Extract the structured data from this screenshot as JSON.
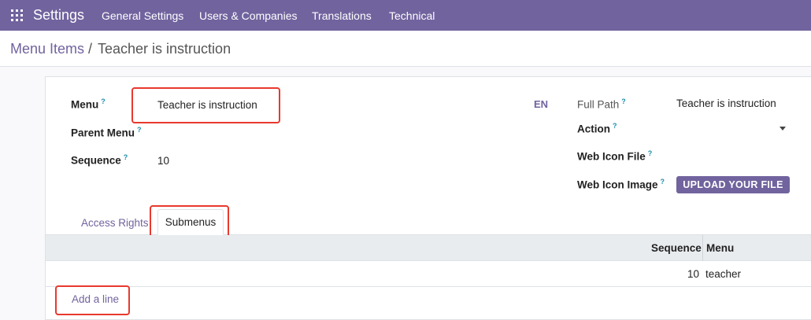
{
  "topbar": {
    "app_name": "Settings",
    "menu": [
      "General Settings",
      "Users & Companies",
      "Translations",
      "Technical"
    ]
  },
  "breadcrumb": {
    "parent": "Menu Items",
    "separator": "/",
    "current": "Teacher is instruction"
  },
  "form": {
    "menu_label": "Menu",
    "menu_value": "Teacher is instruction",
    "parent_menu_label": "Parent Menu",
    "parent_menu_value": "",
    "sequence_label": "Sequence",
    "sequence_value": "10",
    "lang_badge": "EN",
    "full_path_label": "Full Path",
    "full_path_value": "Teacher is instruction",
    "action_label": "Action",
    "action_value": "",
    "web_icon_file_label": "Web Icon File",
    "web_icon_image_label": "Web Icon Image",
    "upload_label": "UPLOAD YOUR FILE",
    "help_mark": "?"
  },
  "tabs": [
    {
      "label": "Access Rights",
      "active": false
    },
    {
      "label": "Submenus",
      "active": true
    }
  ],
  "submenus_table": {
    "columns": [
      "Sequence",
      "Menu"
    ],
    "rows": [
      {
        "sequence": "10",
        "menu": "teacher"
      }
    ],
    "add_line_label": "Add a line"
  },
  "colors": {
    "brand": "#71639e",
    "highlight": "#e8392e",
    "help": "#1d8ea8"
  }
}
